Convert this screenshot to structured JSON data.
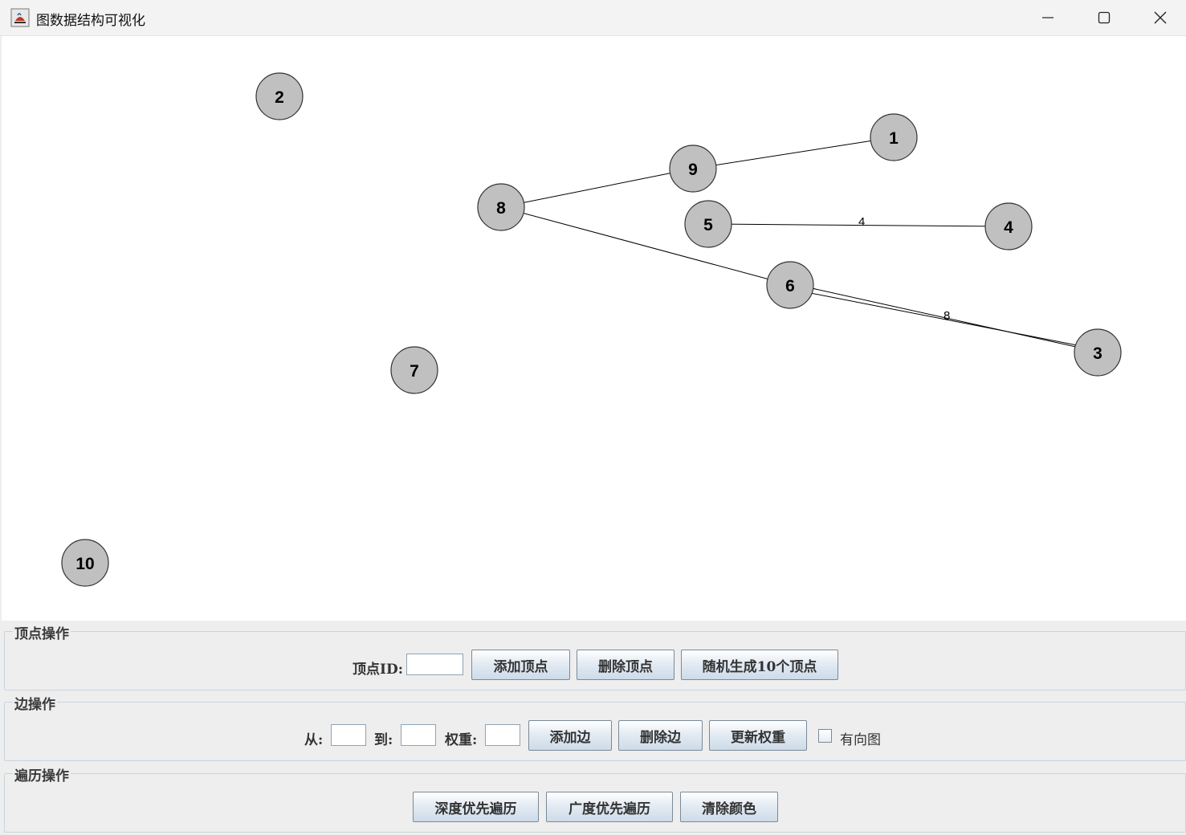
{
  "window": {
    "title": "图数据结构可视化",
    "icon": "java-cup-icon",
    "controls": [
      "minimize-icon",
      "maximize-icon",
      "close-icon"
    ]
  },
  "graph": {
    "nodes": [
      {
        "id": "1"
      },
      {
        "id": "2"
      },
      {
        "id": "3"
      },
      {
        "id": "4"
      },
      {
        "id": "5"
      },
      {
        "id": "6"
      },
      {
        "id": "7"
      },
      {
        "id": "8"
      },
      {
        "id": "9"
      },
      {
        "id": "10"
      }
    ],
    "edges": [
      {
        "from": "8",
        "to": "9",
        "weight": ""
      },
      {
        "from": "9",
        "to": "1",
        "weight": ""
      },
      {
        "from": "8",
        "to": "6",
        "weight": ""
      },
      {
        "from": "5",
        "to": "4",
        "weight": "4"
      },
      {
        "from": "6",
        "to": "3",
        "weight": "8"
      },
      {
        "from": "3",
        "to": "6",
        "weight": ""
      }
    ],
    "node_fill": "#c0c0c0"
  },
  "vertex_ops": {
    "title": "顶点操作",
    "id_label": "顶点ID:",
    "id_value": "",
    "add_label": "添加顶点",
    "delete_label": "删除顶点",
    "random_label": "随机生成10个顶点"
  },
  "edge_ops": {
    "title": "边操作",
    "from_label": "从:",
    "from_value": "",
    "to_label": "到:",
    "to_value": "",
    "weight_label": "权重:",
    "weight_value": "",
    "add_label": "添加边",
    "delete_label": "删除边",
    "update_label": "更新权重",
    "directed_label": "有向图",
    "directed_checked": false
  },
  "traverse_ops": {
    "title": "遍历操作",
    "dfs_label": "深度优先遍历",
    "bfs_label": "广度优先遍历",
    "clear_label": "清除颜色"
  }
}
